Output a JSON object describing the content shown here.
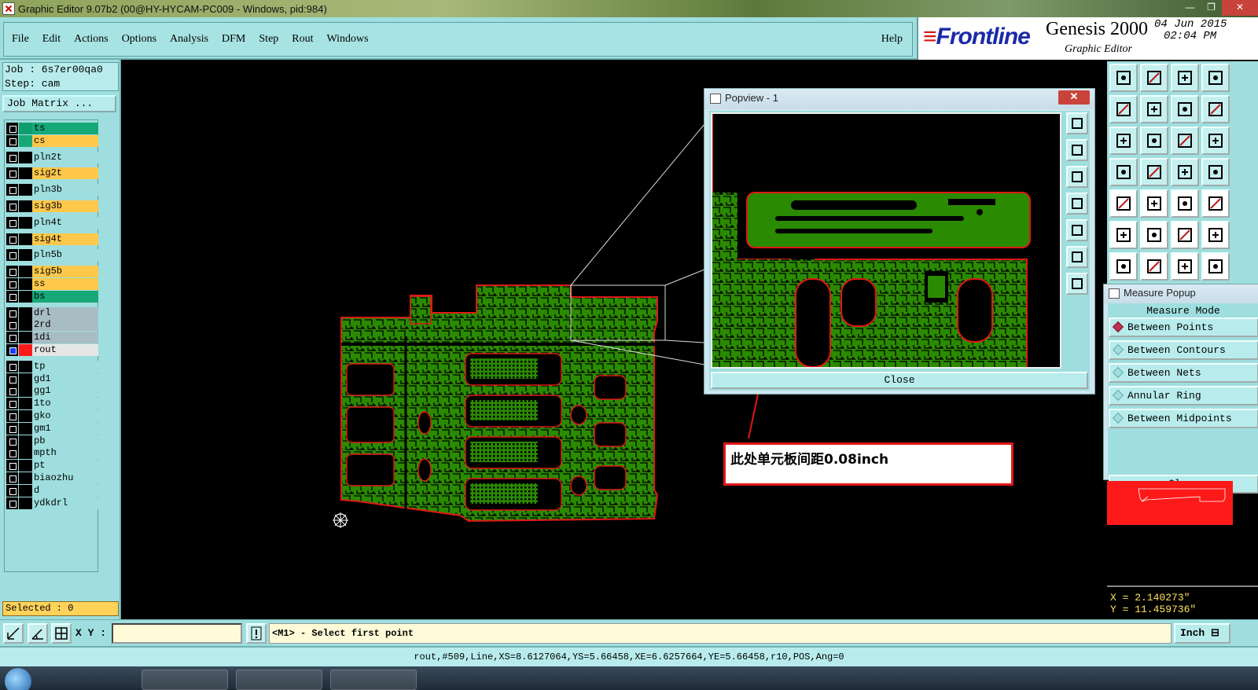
{
  "window": {
    "title": "Graphic Editor 9.07b2 (00@HY-HYCAM-PC009 - Windows, pid:984)",
    "controls": [
      "—",
      "❐",
      "✕"
    ]
  },
  "menu": {
    "items": [
      "File",
      "Edit",
      "Actions",
      "Options",
      "Analysis",
      "DFM",
      "Step",
      "Rout",
      "Windows"
    ],
    "help": "Help"
  },
  "brand": {
    "logo": "Frontline",
    "product": "Genesis 2000",
    "subtitle": "Graphic Editor",
    "date": "04 Jun 2015",
    "time": "02:04 PM"
  },
  "job": {
    "job_line": "Job : 6s7er00qa0",
    "step_line": "Step: cam",
    "matrix_button": "Job Matrix ..."
  },
  "layers": [
    {
      "name": "ts",
      "color": "#0e9e6e",
      "bg": "#17a878",
      "checked": false
    },
    {
      "name": "cs",
      "color": "#17a878",
      "bg": "#ffc84a",
      "checked": false
    },
    {
      "name": "pln2t",
      "color": "#000000",
      "bg": "#9fdede",
      "checked": false
    },
    {
      "name": "sig2t",
      "color": "#000000",
      "bg": "#ffc84a",
      "checked": false
    },
    {
      "name": "pln3b",
      "color": "#000000",
      "bg": "#9fdede",
      "checked": false
    },
    {
      "name": "sig3b",
      "color": "#000000",
      "bg": "#ffc84a",
      "checked": false
    },
    {
      "name": "pln4t",
      "color": "#000000",
      "bg": "#9fdede",
      "checked": false
    },
    {
      "name": "sig4t",
      "color": "#000000",
      "bg": "#ffc84a",
      "checked": false
    },
    {
      "name": "pln5b",
      "color": "#000000",
      "bg": "#9fdede",
      "checked": false
    },
    {
      "name": "sig5b",
      "color": "#000000",
      "bg": "#ffc84a",
      "checked": false
    },
    {
      "name": "ss",
      "color": "#000000",
      "bg": "#ffc84a",
      "checked": false
    },
    {
      "name": "bs",
      "color": "#000000",
      "bg": "#17a878",
      "checked": false
    },
    {
      "name": "drl",
      "color": "#000000",
      "bg": "#a8bcc4",
      "checked": false
    },
    {
      "name": "2rd",
      "color": "#000000",
      "bg": "#a8bcc4",
      "checked": false
    },
    {
      "name": "1di",
      "color": "#000000",
      "bg": "#a8bcc4",
      "checked": false
    },
    {
      "name": "rout",
      "color": "#ff1a1a",
      "bg": "#e6e6e6",
      "checked": true
    },
    {
      "name": "tp",
      "color": "#000000",
      "bg": "#9fdede",
      "checked": false
    },
    {
      "name": "gd1",
      "color": "#000000",
      "bg": "#9fdede",
      "checked": false
    },
    {
      "name": "gg1",
      "color": "#000000",
      "bg": "#9fdede",
      "checked": false
    },
    {
      "name": "1to",
      "color": "#000000",
      "bg": "#9fdede",
      "checked": false
    },
    {
      "name": "gko",
      "color": "#000000",
      "bg": "#9fdede",
      "checked": false
    },
    {
      "name": "gm1",
      "color": "#000000",
      "bg": "#9fdede",
      "checked": false
    },
    {
      "name": "pb",
      "color": "#000000",
      "bg": "#9fdede",
      "checked": false
    },
    {
      "name": "mpth",
      "color": "#000000",
      "bg": "#9fdede",
      "checked": false
    },
    {
      "name": "pt",
      "color": "#000000",
      "bg": "#9fdede",
      "checked": false
    },
    {
      "name": "biaozhu",
      "color": "#000000",
      "bg": "#9fdede",
      "checked": false
    },
    {
      "name": "d",
      "color": "#000000",
      "bg": "#9fdede",
      "checked": false
    },
    {
      "name": "ydkdrl",
      "color": "#000000",
      "bg": "#9fdede",
      "checked": false
    }
  ],
  "selected": "Selected : 0",
  "popview": {
    "title": "Popview - 1",
    "close_button": "Close",
    "close_x": "✕"
  },
  "measure": {
    "title": "Measure Popup",
    "mode_heading": "Measure Mode",
    "options": [
      {
        "label": "Between Points",
        "selected": true
      },
      {
        "label": "Between Contours",
        "selected": false
      },
      {
        "label": "Between Nets",
        "selected": false
      },
      {
        "label": "Annular Ring",
        "selected": false
      },
      {
        "label": "Between Midpoints",
        "selected": false
      }
    ],
    "close_button": "Close"
  },
  "coords": {
    "x": "X = 2.140273\"",
    "y": "Y = 11.459736\""
  },
  "annotation": "此处单元板间距0.08inch",
  "command": {
    "xy_label": "X Y :",
    "xy_value": "",
    "prompt": "<M1> - Select first point",
    "units": "Inch ⊟"
  },
  "status": "rout,#509,Line,XS=8.6127064,YS=5.66458,XE=6.6257664,YE=5.66458,r10,POS,Ang=0",
  "colors": {
    "board_fill": "#2a8a00",
    "board_outline": "#e01818",
    "panel_bg": "#9fdede",
    "annotation_border": "#e01818"
  }
}
